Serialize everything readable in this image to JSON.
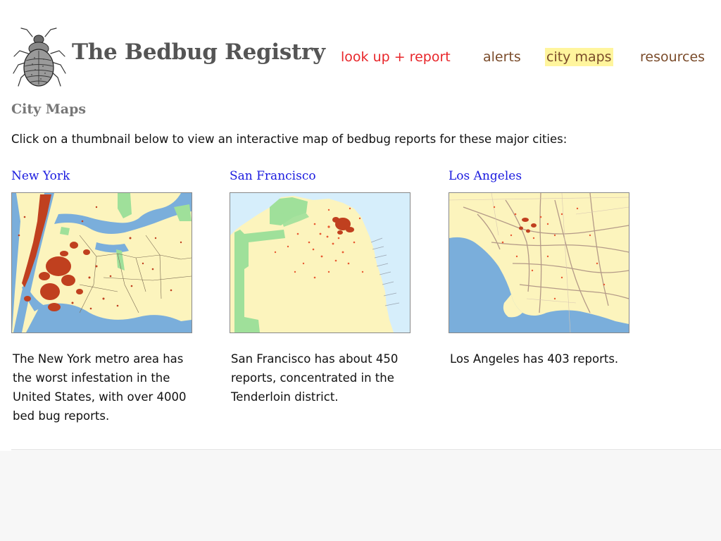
{
  "colors": {
    "nav_report": "#e8262a",
    "nav_default": "#7a4b2a",
    "nav_active_bg": "#fff59d",
    "city_link": "#1a1adf",
    "water": "#7aaedb",
    "land": "#fcf4bd",
    "park": "#9fe09a",
    "report_dot": "#c0401f"
  },
  "header": {
    "logo_icon": "bedbug-icon",
    "site_title": "The Bedbug Registry",
    "nav": {
      "report_label": "look up + report",
      "alerts_label": "alerts",
      "maps_label": "city maps",
      "resources_label": "resources",
      "active": "city maps"
    }
  },
  "main": {
    "heading": "City Maps",
    "intro": "Click on a thumbnail below to view an interactive map of bedbug reports for these major cities:",
    "cities": [
      {
        "name": "New York",
        "map_icon": "new-york-map-thumbnail",
        "description": "The New York metro area has the worst infestation in the United States, with over 4000 bed bug reports."
      },
      {
        "name": "San Francisco",
        "map_icon": "san-francisco-map-thumbnail",
        "description": "San Francisco has about 450 reports, concentrated in the Tenderloin district."
      },
      {
        "name": "Los Angeles",
        "map_icon": "los-angeles-map-thumbnail",
        "description": "Los Angeles has 403 reports."
      }
    ]
  }
}
